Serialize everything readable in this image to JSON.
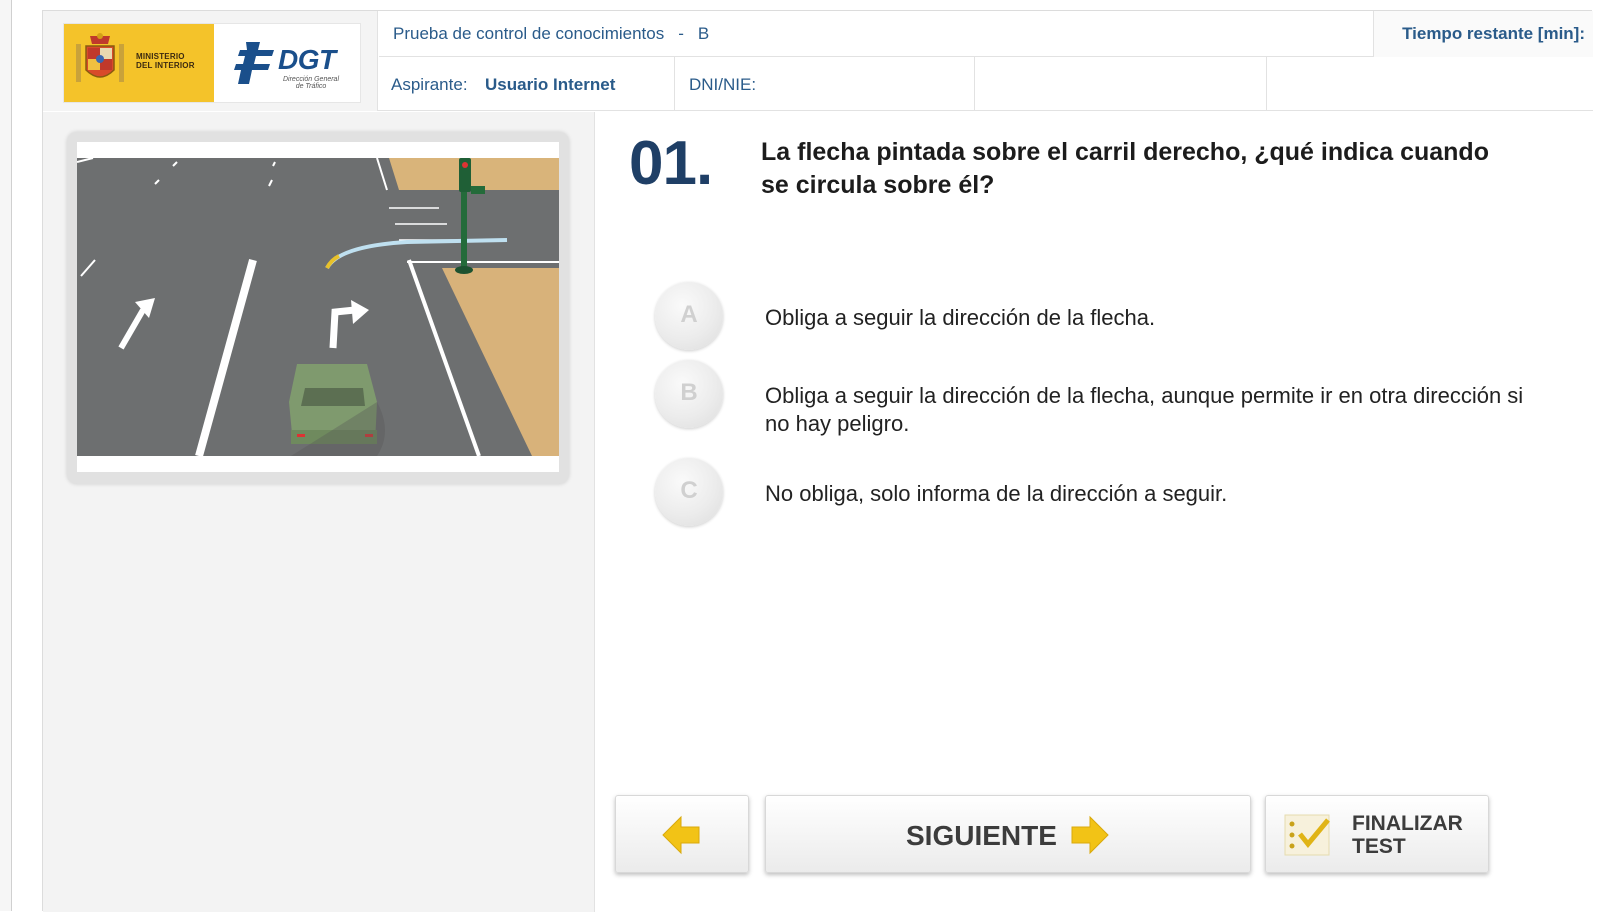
{
  "header": {
    "logos": {
      "ministerio_line1": "MINISTERIO",
      "ministerio_line2": "DEL INTERIOR",
      "dgt": "DGT",
      "dgt_sub1": "Dirección General",
      "dgt_sub2": "de Tráfico"
    },
    "test_title": "Prueba de control de conocimientos",
    "separator": "-",
    "permit": "B",
    "time_label": "Tiempo restante [min]:",
    "aspirante_label": "Aspirante:",
    "aspirante_value": "Usuario Internet",
    "dni_label": "DNI/NIE:"
  },
  "question": {
    "number": "01.",
    "text": "La flecha pintada sobre el carril derecho, ¿qué indica cuando se circula sobre él?",
    "answers": [
      {
        "letter": "A",
        "text": "Obliga a seguir la dirección de la flecha."
      },
      {
        "letter": "B",
        "text": "Obliga a seguir la dirección de la flecha, aunque permite ir en otra dirección si no hay peligro."
      },
      {
        "letter": "C",
        "text": "No obliga, solo informa de la dirección a seguir."
      }
    ]
  },
  "buttons": {
    "next_label": "SIGUIENTE",
    "finish_label_line1": "FINALIZAR",
    "finish_label_line2": "TEST"
  },
  "colors": {
    "accent_blue": "#2a5b8a",
    "number_blue": "#1f3f66",
    "arrow_yellow": "#f2c316",
    "ministerio_yellow": "#f4c32a"
  }
}
